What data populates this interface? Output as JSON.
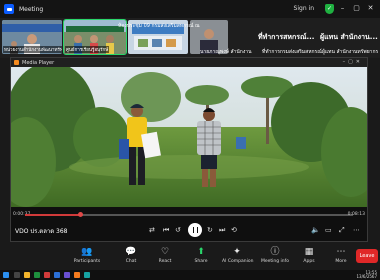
{
  "app": {
    "title": "Meeting",
    "signin": "Sign in"
  },
  "participants": [
    {
      "label": "หน่วยงานสำนักงานพัฒนาทรัพยากร",
      "active": false
    },
    {
      "label": "ศูนย์การเรียนรู้อนุรักษ์",
      "active": true
    },
    {
      "label": "",
      "active": false
    }
  ],
  "speaker": {
    "title": "ห้องประชุม 09 กรมส่งเสริมสหกรณ์ ณ",
    "side_label": "นายภาณุพงษ์ สำนักงาน"
  },
  "header_text": {
    "left_big": "ที่ทำการสหกรณ์...",
    "left_sub": "ที่ทำการกรมส่งเสริมสหกรณ์",
    "right_big": "ผู้แทน สำนักงาน...",
    "right_sub": "ผู้แทน สำนักงานทรัพยากร"
  },
  "player": {
    "title": "Media Player",
    "video_name": "VDO ปร.ตลาด 368",
    "time_elapsed": "0:00:37",
    "time_total": "0:08:13",
    "progress": 0.17
  },
  "toolbar": {
    "items": [
      {
        "label": "Participants",
        "icon": "people-icon",
        "glyph": "👥"
      },
      {
        "label": "Chat",
        "icon": "chat-icon",
        "glyph": "💬"
      },
      {
        "label": "React",
        "icon": "heart-icon",
        "glyph": "♡"
      },
      {
        "label": "Share",
        "icon": "share-icon",
        "glyph": "⬆"
      },
      {
        "label": "AI Companion",
        "icon": "ai-icon",
        "glyph": "✦"
      },
      {
        "label": "Meeting info",
        "icon": "info-icon",
        "glyph": "ⓘ"
      },
      {
        "label": "Apps",
        "icon": "apps-icon",
        "glyph": "▦"
      },
      {
        "label": "More",
        "icon": "more-icon",
        "glyph": "⋯"
      }
    ],
    "leave": "Leave"
  },
  "taskbar": {
    "time": "13:55",
    "date": "13/6/2567"
  },
  "colors": {
    "accent": "#0b5cff",
    "active_border": "#2ad66b",
    "leave": "#e02828",
    "progress": "#d13a3a"
  }
}
